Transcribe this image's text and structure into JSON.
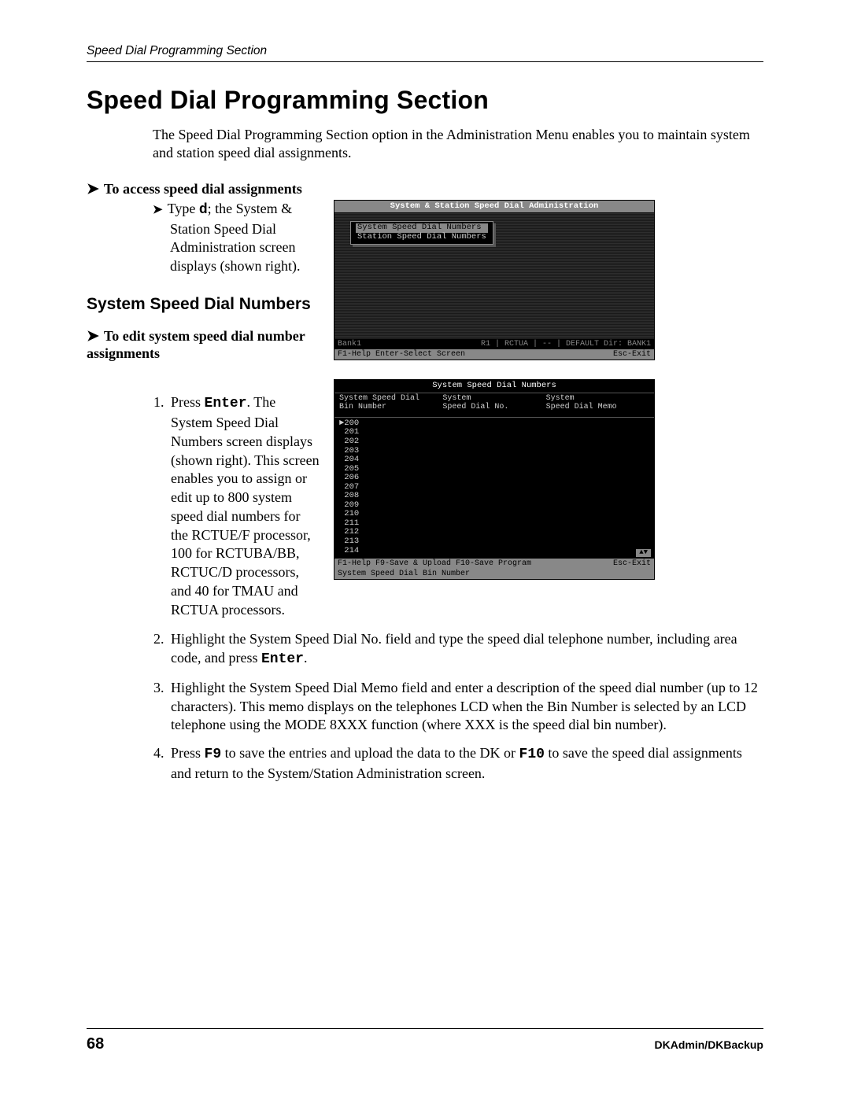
{
  "running_head": "Speed Dial Programming Section",
  "title": "Speed Dial Programming Section",
  "intro": "The Speed Dial Programming Section option in the Administration Menu enables you to maintain system and station speed dial assignments.",
  "access_heading": "To access speed dial assignments",
  "access_bullet_pre": "Type ",
  "access_bullet_key": "d",
  "access_bullet_post": "; the System & Station Speed Dial Administration screen displays (shown right).",
  "h2": "System Speed Dial Numbers",
  "edit_heading": "To edit system speed dial number assignments",
  "step1_pre": "Press ",
  "step1_key": "Enter",
  "step1_post": ". The System Speed Dial Numbers screen displays (shown right). This screen enables you to assign or edit up to 800 system speed dial numbers for the RCTUE/F processor, 100 for RCTUBA/BB, RCTUC/D processors, and 40 for TMAU and RCTUA processors.",
  "step2_pre": "Highlight the System Speed Dial No. field and type the speed dial telephone number, including area code, and press ",
  "step2_key": "Enter",
  "step2_post": ".",
  "step3": "Highlight the System Speed Dial Memo field and enter a description of the speed dial number (up to 12 characters). This memo displays on the telephones LCD when the Bin Number is selected by an LCD telephone using the MODE 8XXX function (where XXX is the speed dial bin number).",
  "step4_pre": "Press ",
  "step4_key1": "F9",
  "step4_mid": " to save the entries and upload the data to the DK or ",
  "step4_key2": "F10",
  "step4_post": " to save the speed dial assignments and return to the System/Station Administration screen.",
  "ss1": {
    "title": "System & Station Speed Dial Administration",
    "menu": [
      "System Speed Dial Numbers",
      "Station Speed Dial Numbers"
    ],
    "status_left": "Bank1",
    "status_right": "R1 | RCTUA | -- | DEFAULT    Dir: BANK1",
    "help_left": "F1-Help  Enter-Select Screen",
    "help_right": "Esc-Exit"
  },
  "ss2": {
    "title": "System Speed Dial Numbers",
    "col1": "System Speed Dial\nBin Number",
    "col2": "System\nSpeed Dial No.",
    "col3": "System\nSpeed Dial Memo",
    "bins": [
      "200",
      "201",
      "202",
      "203",
      "204",
      "205",
      "206",
      "207",
      "208",
      "209",
      "210",
      "211",
      "212",
      "213",
      "214"
    ],
    "scroll": "▲▼",
    "help_left": "F1-Help  F9-Save & Upload  F10-Save Program",
    "help_right": "Esc-Exit",
    "hint": "System Speed Dial Bin Number"
  },
  "page_number": "68",
  "doc_id": "DKAdmin/DKBackup"
}
